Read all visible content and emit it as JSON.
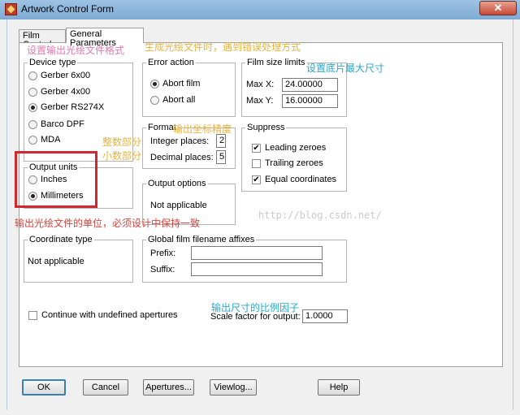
{
  "window": {
    "title": "Artwork Control Form",
    "close_label": "✕"
  },
  "tabs": [
    {
      "label": "Film Control"
    },
    {
      "label": "General Parameters"
    }
  ],
  "device_type": {
    "legend": "Device type",
    "options": [
      "Gerber 6x00",
      "Gerber 4x00",
      "Gerber RS274X",
      "Barco DPF",
      "MDA"
    ],
    "selected": "Gerber RS274X"
  },
  "output_units": {
    "legend": "Output units",
    "options": [
      "Inches",
      "Millimeters"
    ],
    "selected": "Millimeters"
  },
  "error_action": {
    "legend": "Error action",
    "options": [
      "Abort film",
      "Abort all"
    ],
    "selected": "Abort film"
  },
  "format": {
    "legend": "Format",
    "integer_label": "Integer places:",
    "integer_value": "2",
    "decimal_label": "Decimal places:",
    "decimal_value": "5"
  },
  "output_options": {
    "legend": "Output options",
    "text": "Not applicable"
  },
  "film_size_limits": {
    "legend": "Film size limits",
    "max_x_label": "Max X:",
    "max_x_value": "24.00000",
    "max_y_label": "Max Y:",
    "max_y_value": "16.00000"
  },
  "suppress": {
    "legend": "Suppress",
    "options": [
      {
        "label": "Leading zeroes",
        "checked": true
      },
      {
        "label": "Trailing zeroes",
        "checked": false
      },
      {
        "label": "Equal coordinates",
        "checked": true
      }
    ]
  },
  "coordinate_type": {
    "legend": "Coordinate type",
    "text": "Not applicable"
  },
  "filename_affixes": {
    "legend": "Global film filename affixes",
    "prefix_label": "Prefix:",
    "prefix_value": "",
    "suffix_label": "Suffix:",
    "suffix_value": ""
  },
  "continue_undefined": {
    "label": "Continue with undefined apertures",
    "checked": false
  },
  "scale_factor": {
    "label": "Scale factor for output:",
    "value": "1.0000"
  },
  "buttons": {
    "ok": "OK",
    "cancel": "Cancel",
    "apertures": "Apertures...",
    "viewlog": "Viewlog...",
    "help": "Help"
  },
  "annotations": {
    "output_format": "设置输出光绘文件格式",
    "error_handling": "生成光绘文件时，遇到错误处理方式",
    "film_size": "设置底片最大尺寸",
    "coord_precision": "输出坐标精度",
    "integer_part": "整数部分",
    "decimal_part": "小数部分",
    "units_note": "输出光绘文件的单位，必须设计中保持一致",
    "scale_factor": "输出尺寸的比例因子"
  },
  "watermark": "http://blog.csdn.net/",
  "colors": {
    "annotation_pink": "#e07bb0",
    "annotation_yellow": "#e8b23a",
    "annotation_cyan": "#2aa7c9",
    "annotation_red": "#d9413a",
    "highlight_box": "#d3262f"
  }
}
